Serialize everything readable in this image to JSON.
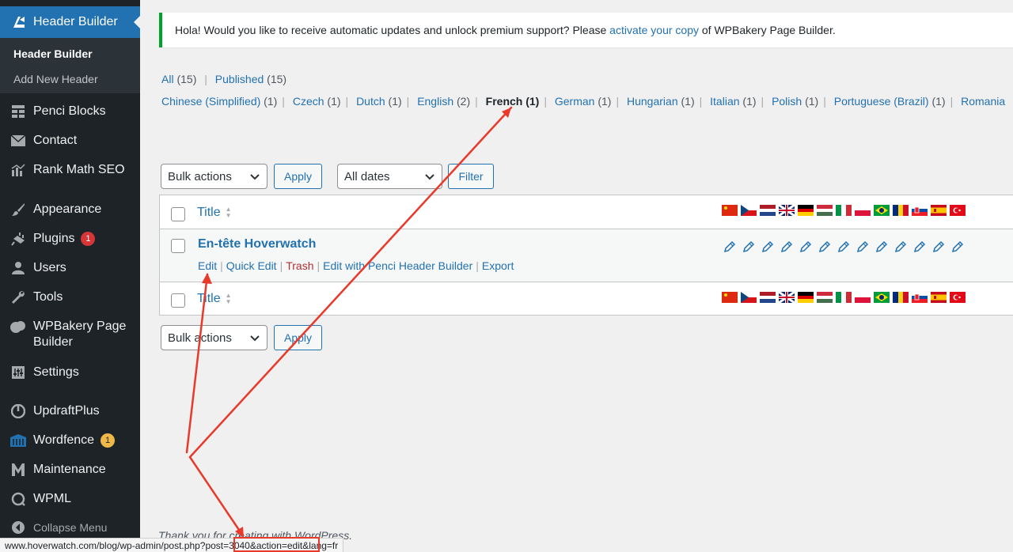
{
  "sidebar": {
    "active": {
      "label": "Header Builder",
      "icon": "header-builder-icon"
    },
    "submenu": [
      {
        "label": "Header Builder",
        "current": true
      },
      {
        "label": "Add New Header",
        "current": false
      }
    ],
    "items": [
      {
        "label": "Penci Blocks",
        "icon": "blocks-icon"
      },
      {
        "label": "Contact",
        "icon": "mail-icon"
      },
      {
        "label": "Rank Math SEO",
        "icon": "chart-icon"
      },
      {
        "label": "Appearance",
        "icon": "paintbrush-icon"
      },
      {
        "label": "Plugins",
        "icon": "plug-icon",
        "badge": "1"
      },
      {
        "label": "Users",
        "icon": "user-icon"
      },
      {
        "label": "Tools",
        "icon": "wrench-icon"
      },
      {
        "label": "WPBakery Page",
        "label2": "Builder",
        "icon": "bakery-icon"
      },
      {
        "label": "Settings",
        "icon": "settings-icon"
      },
      {
        "label": "UpdraftPlus",
        "icon": "updraft-icon"
      },
      {
        "label": "Wordfence",
        "icon": "wordfence-icon",
        "badge": "1"
      },
      {
        "label": "Maintenance",
        "icon": "maintenance-icon"
      },
      {
        "label": "WPML",
        "icon": "wpml-icon"
      },
      {
        "label": "Collapse Menu",
        "icon": "collapse-icon"
      }
    ]
  },
  "notice": {
    "before": "Hola! Would you like to receive automatic updates and unlock premium support? Please ",
    "link": "activate your copy",
    "after": " of WPBakery Page Builder."
  },
  "status_filters": [
    {
      "label": "All",
      "count": "(15)"
    },
    {
      "label": "Published",
      "count": "(15)"
    }
  ],
  "language_filters": [
    {
      "label": "Chinese (Simplified)",
      "count": "(1)"
    },
    {
      "label": "Czech",
      "count": "(1)"
    },
    {
      "label": "Dutch",
      "count": "(1)"
    },
    {
      "label": "English",
      "count": "(2)"
    },
    {
      "label": "French (1)",
      "count": "",
      "current": true
    },
    {
      "label": "German",
      "count": "(1)"
    },
    {
      "label": "Hungarian",
      "count": "(1)"
    },
    {
      "label": "Italian",
      "count": "(1)"
    },
    {
      "label": "Polish",
      "count": "(1)"
    },
    {
      "label": "Portuguese (Brazil)",
      "count": "(1)"
    },
    {
      "label": "Romania",
      "count": ""
    }
  ],
  "toolbar": {
    "bulk_actions": "Bulk actions",
    "apply": "Apply",
    "dates": "All dates",
    "filter": "Filter"
  },
  "table": {
    "title_header": "Title",
    "languages": [
      "zh",
      "cs",
      "nl",
      "en",
      "de",
      "hu",
      "it",
      "pl",
      "pt-br",
      "ro",
      "sk",
      "es",
      "tr"
    ],
    "row": {
      "title": "En-tête Hoverwatch",
      "actions": [
        "Edit",
        "Quick Edit",
        "Trash",
        "Edit with Penci Header Builder",
        "Export"
      ]
    }
  },
  "footer": {
    "text": "Thank you for creating with WordPress."
  },
  "statusbar": {
    "url": "www.hoverwatch.com/blog/wp-admin/post.php?post=3040&action=edit&lang=fr"
  },
  "colors": {
    "accent": "#2271b1",
    "annotation": "#e8392a",
    "sidebar": "#1d2327"
  }
}
